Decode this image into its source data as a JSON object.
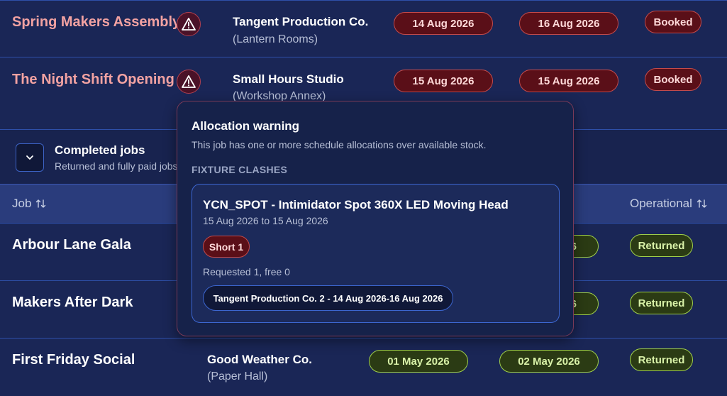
{
  "booked_jobs": [
    {
      "title": "Spring Makers Assembly",
      "client": "Tangent Production Co.",
      "venue": "(Lantern Rooms)",
      "start": "14 Aug 2026",
      "end": "16 Aug 2026",
      "status": "Booked"
    },
    {
      "title": "The Night Shift Opening",
      "client": "Small Hours Studio",
      "venue": "(Workshop Annex)",
      "start": "15 Aug 2026",
      "end": "15 Aug 2026",
      "status": "Booked"
    }
  ],
  "completed_section": {
    "title": "Completed jobs",
    "subtitle": "Returned and fully paid jobs"
  },
  "table_headers": {
    "job": "Job",
    "operational": "Operational"
  },
  "completed_jobs": [
    {
      "title": "Arbour Lane Gala",
      "end_partial": "6",
      "status": "Returned"
    },
    {
      "title": "Makers After Dark",
      "end_partial": "6",
      "status": "Returned"
    },
    {
      "title": "First Friday Social",
      "client": "Good Weather Co.",
      "venue": "(Paper Hall)",
      "start": "01 May 2026",
      "end": "02 May 2026",
      "status": "Returned"
    }
  ],
  "popover": {
    "title": "Allocation warning",
    "description": "This job has one or more schedule allocations over available stock.",
    "section_label": "FIXTURE CLASHES",
    "clash": {
      "fixture": "YCN_SPOT - Intimidator Spot 360X LED Moving Head",
      "dates": "15 Aug 2026 to 15 Aug 2026",
      "shortage": "Short 1",
      "requested": "Requested 1, free 0",
      "conflict": "Tangent Production Co. 2 - 14 Aug 2026-16 Aug 2026"
    }
  },
  "icons": {
    "warning": "warning-triangle-icon",
    "chevron": "chevron-down-icon",
    "sort": "sort-arrows-icon"
  },
  "colors": {
    "booked_title": "#f2a2a2",
    "danger_pill": "#5a0f18",
    "success_pill": "#2b3b14",
    "accent_border": "#3c66d0"
  }
}
